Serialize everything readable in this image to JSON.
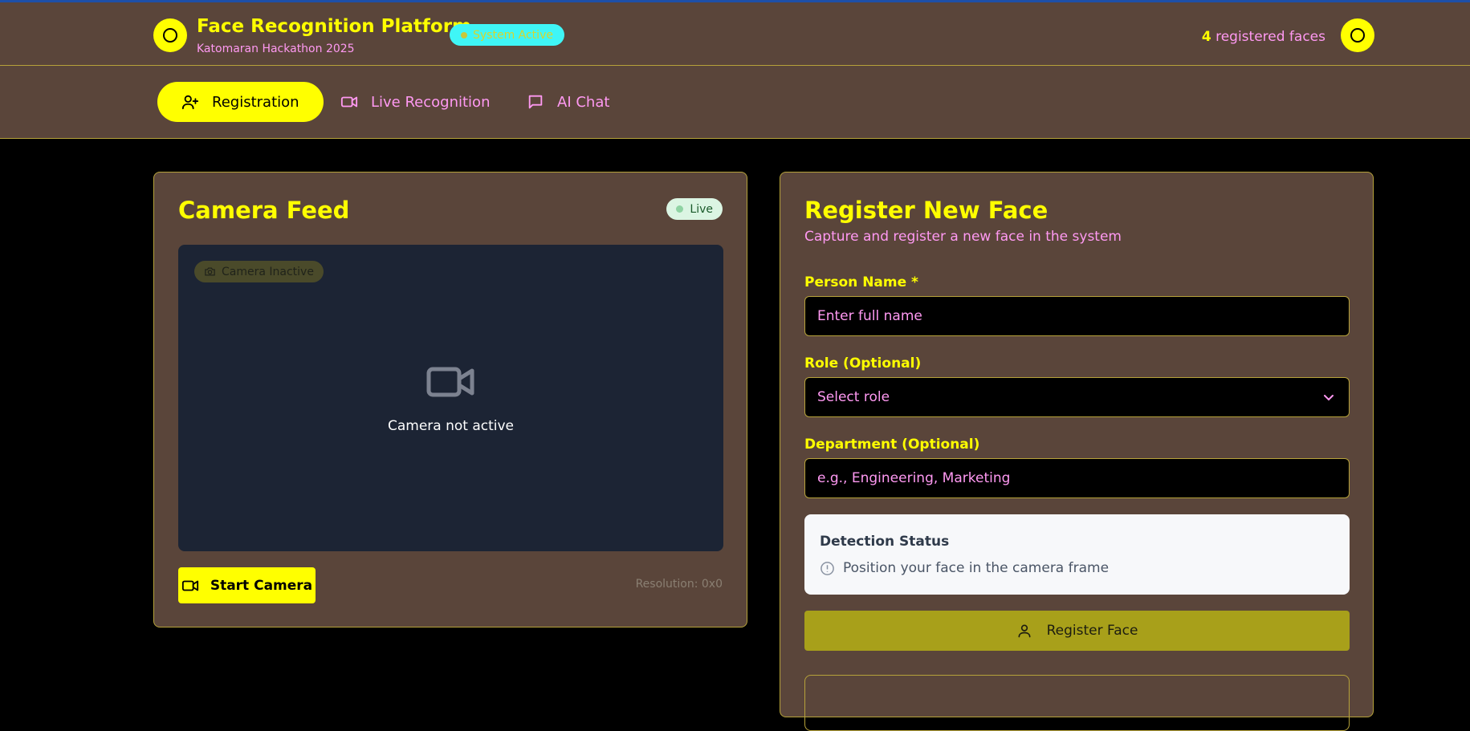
{
  "header": {
    "title": "Face Recognition Platform",
    "subtitle": "Katomaran Hackathon 2025",
    "system_status": "System Active",
    "registered_count": "4",
    "registered_label": "registered faces"
  },
  "nav": {
    "tabs": [
      {
        "label": "Registration",
        "icon": "user-plus-icon",
        "active": true
      },
      {
        "label": "Live Recognition",
        "icon": "video-icon",
        "active": false
      },
      {
        "label": "AI Chat",
        "icon": "chat-icon",
        "active": false
      }
    ]
  },
  "camera": {
    "title": "Camera Feed",
    "live_label": "Live",
    "inactive_badge": "Camera Inactive",
    "inactive_text": "Camera not active",
    "start_button": "Start Camera",
    "resolution": "Resolution: 0x0"
  },
  "register": {
    "title": "Register New Face",
    "subtitle": "Capture and register a new face in the system",
    "name_label": "Person Name *",
    "name_placeholder": "Enter full name",
    "role_label": "Role (Optional)",
    "role_value": "Select role",
    "dept_label": "Department (Optional)",
    "dept_placeholder": "e.g., Engineering, Marketing",
    "detection_title": "Detection Status",
    "detection_msg": "Position your face in the camera frame",
    "register_button": "Register Face"
  },
  "colors": {
    "accent": "#ffff00",
    "panel": "#5a453a",
    "pink_text": "#ff99f2",
    "border": "#b6a23a",
    "status_cyan": "#3ff6f6"
  }
}
